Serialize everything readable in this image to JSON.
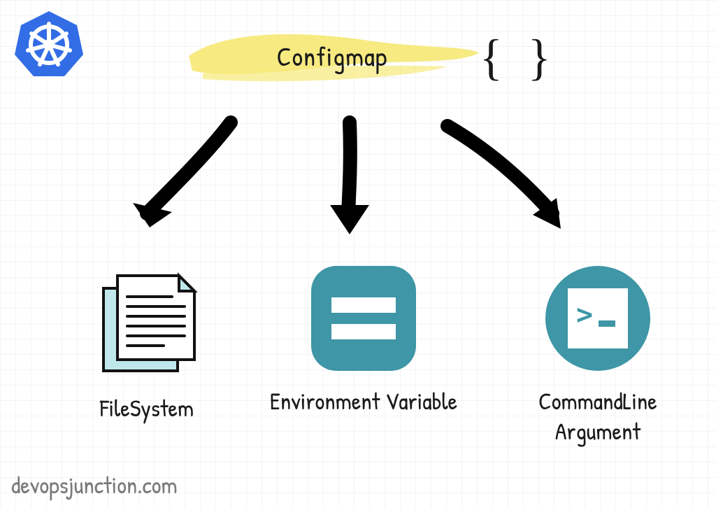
{
  "title": "Configmap",
  "braces": "{ }",
  "items": [
    {
      "label": "FileSystem",
      "icon": "file-stack"
    },
    {
      "label": "Environment Variable",
      "icon": "equals-square"
    },
    {
      "label": "CommandLine\nArgument",
      "icon": "terminal-circle"
    }
  ],
  "footer": "devopsjunction.com",
  "colors": {
    "teal": "#3e96a6",
    "tealLight": "#bfe7ec",
    "highlight": "#f7e97a",
    "k8s": "#326de6"
  }
}
